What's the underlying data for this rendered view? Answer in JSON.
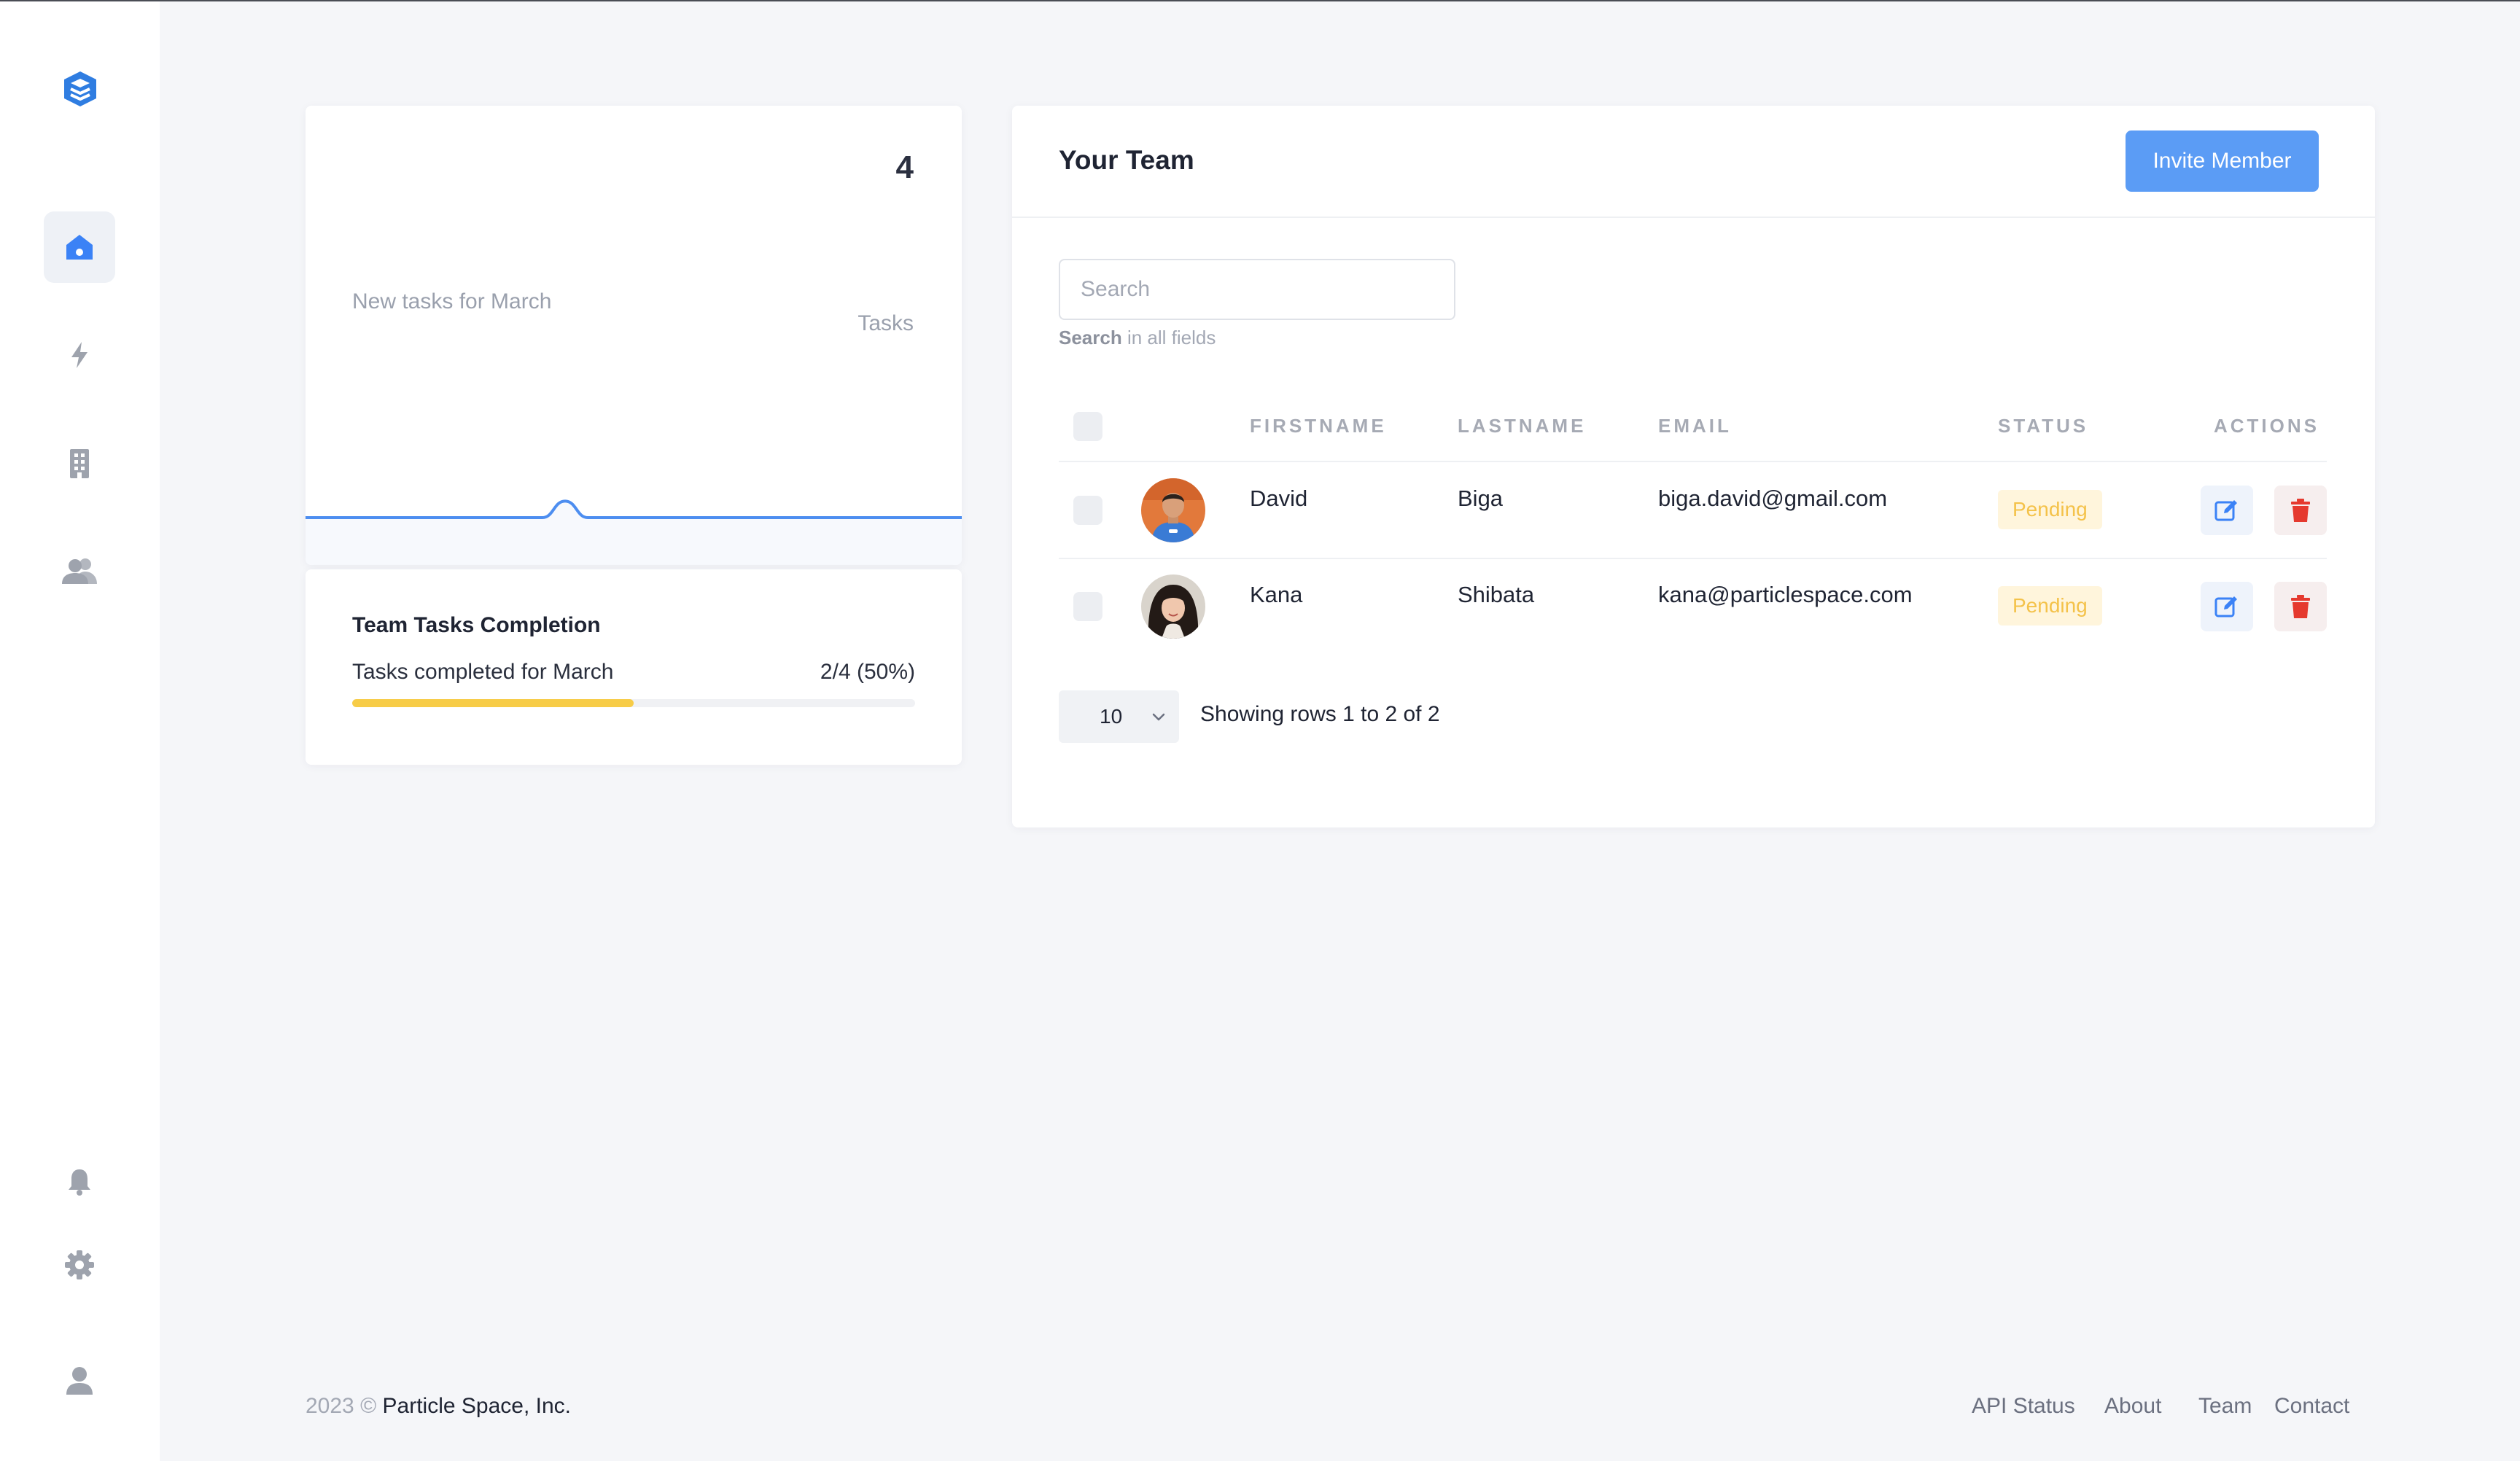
{
  "sidebar": {
    "logo_icon": "layers-logo-icon",
    "items": [
      {
        "icon": "home-icon",
        "active": true
      },
      {
        "icon": "lightning-icon",
        "active": false
      },
      {
        "icon": "building-icon",
        "active": false
      },
      {
        "icon": "users-icon",
        "active": false
      }
    ],
    "bottom_items": [
      {
        "icon": "bell-icon"
      },
      {
        "icon": "gear-icon"
      },
      {
        "icon": "user-icon"
      }
    ]
  },
  "tasks_card": {
    "count": "4",
    "count_unit": "Tasks",
    "label": "New tasks for March",
    "chart_data": {
      "type": "area",
      "x": [
        1,
        2,
        3,
        4,
        5,
        6,
        7,
        8,
        9,
        10,
        11,
        12,
        13,
        14,
        15,
        16,
        17,
        18,
        19,
        20,
        21,
        22,
        23,
        24,
        25,
        26,
        27,
        28,
        29,
        30,
        31
      ],
      "series": [
        {
          "values": [
            0,
            0,
            0,
            0,
            0,
            0,
            0,
            0,
            0,
            0,
            0,
            0,
            1,
            0,
            0,
            0,
            0,
            0,
            0,
            0,
            0,
            0,
            0,
            0,
            0,
            0,
            0,
            0,
            0,
            0,
            0
          ]
        }
      ],
      "ylim": [
        0,
        25
      ],
      "grid": false,
      "legend": "none",
      "line_color": "#4d8ef0"
    }
  },
  "completion_card": {
    "title": "Team Tasks Completion",
    "subtitle": "Tasks completed for March",
    "value_label": "2/4 (50%)",
    "progress_fraction": 0.5,
    "bar_color": "#f7cc47"
  },
  "team": {
    "title": "Your Team",
    "invite_label": "Invite Member",
    "search": {
      "placeholder": "Search",
      "hint_bold": "Search",
      "hint_rest": " in all fields"
    },
    "columns": [
      "FIRSTNAME",
      "LASTNAME",
      "EMAIL",
      "STATUS",
      "ACTIONS"
    ],
    "rows": [
      {
        "firstname": "David",
        "lastname": "Biga",
        "email": "biga.david@gmail.com",
        "status": "Pending",
        "avatar_icon": "avatar-photo"
      },
      {
        "firstname": "Kana",
        "lastname": "Shibata",
        "email": "kana@particlespace.com",
        "status": "Pending",
        "avatar_icon": "avatar-photo"
      }
    ],
    "rows_per_page": "10",
    "pagination_info": "Showing rows 1 to 2 of 2"
  },
  "footer": {
    "copyright": "2023 © ",
    "company": "Particle Space, Inc.",
    "links": [
      "API Status",
      "About",
      "Team",
      "Contact"
    ]
  },
  "colors": {
    "accent": "#5b9cf5",
    "badge_text": "#f4c24a",
    "badge_bg": "#fff5dc",
    "delete": "#e5392e"
  }
}
